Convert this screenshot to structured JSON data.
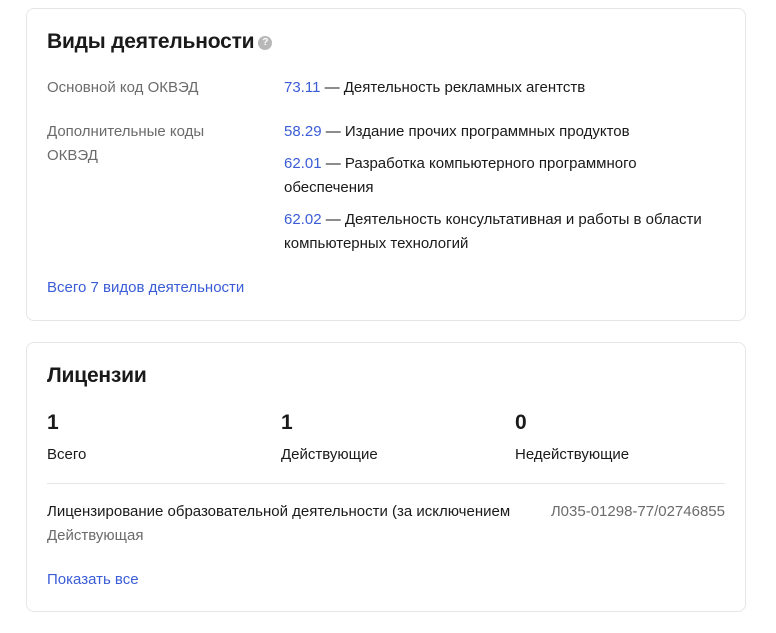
{
  "activities": {
    "title": "Виды деятельности",
    "help_glyph": "?",
    "main_label": "Основной код ОКВЭД",
    "extra_label": "Дополнительные коды ОКВЭД",
    "main": {
      "code": "73.11",
      "text": " — Деятельность рекламных агентств"
    },
    "extra": [
      {
        "code": "58.29",
        "text": " — Издание прочих программных продуктов"
      },
      {
        "code": "62.01",
        "text": " — Разработка компьютерного программного обеспечения"
      },
      {
        "code": "62.02",
        "text": " — Деятельность консультативная и работы в области компьютерных технологий"
      }
    ],
    "all_link": "Всего 7 видов деятельности"
  },
  "licenses": {
    "title": "Лицензии",
    "stats": [
      {
        "value": "1",
        "label": "Всего"
      },
      {
        "value": "1",
        "label": "Действующие"
      },
      {
        "value": "0",
        "label": "Недействующие"
      }
    ],
    "items": [
      {
        "name": "Лицензирование образовательной деятельности (за исключением",
        "status": "Действующая",
        "number": "Л035-01298-77/02746855"
      }
    ],
    "show_all": "Показать все"
  },
  "colors": {
    "link": "#3a5cd6",
    "muted": "#6b6b6b",
    "text": "#1a1a1a",
    "border": "#e6e6e6"
  }
}
